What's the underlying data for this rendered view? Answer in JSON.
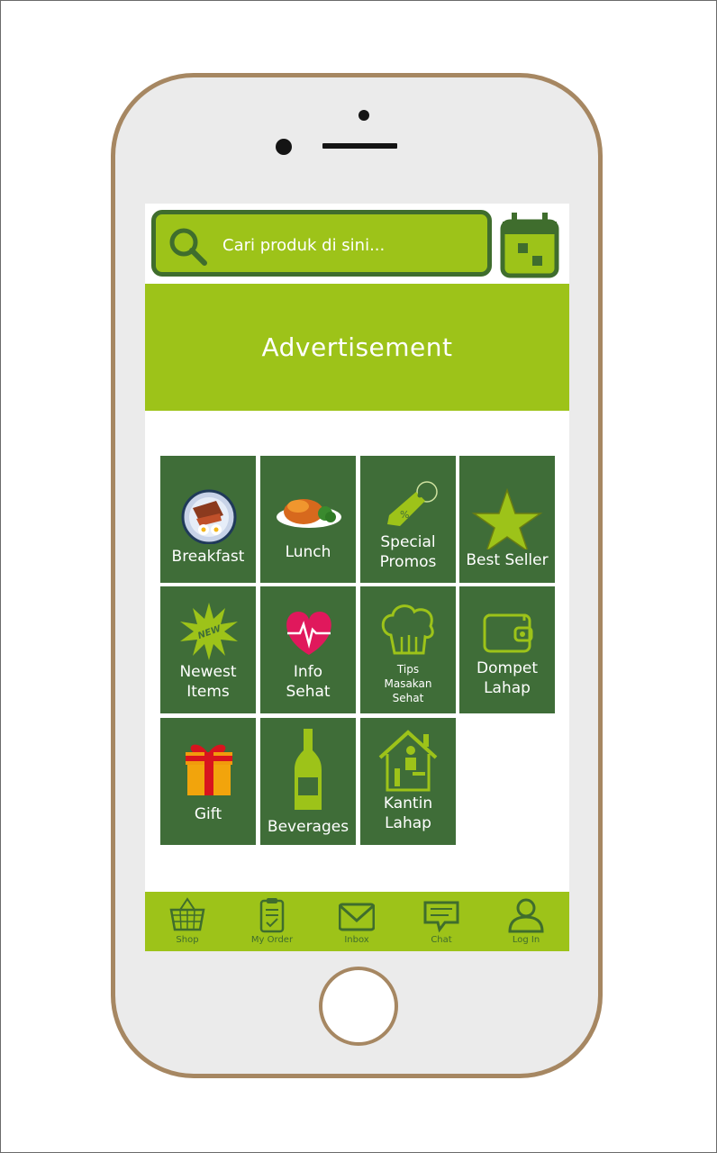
{
  "search": {
    "placeholder": "Cari produk di sini..."
  },
  "banner": {
    "text": "Advertisement"
  },
  "categories": [
    {
      "label": "Breakfast"
    },
    {
      "label": "Lunch"
    },
    {
      "label": "Special\nPromos"
    },
    {
      "label": "Best Seller"
    },
    {
      "label": "Newest\nItems",
      "badge": "NEW"
    },
    {
      "label": "Info\nSehat"
    },
    {
      "label": "Tips\nMasakan\nSehat"
    },
    {
      "label": "Dompet\nLahap"
    },
    {
      "label": "Gift"
    },
    {
      "label": "Beverages"
    },
    {
      "label": "Kantin\nLahap"
    }
  ],
  "promo_tag": "%",
  "nav": [
    {
      "label": "Shop",
      "icon": "basket-icon"
    },
    {
      "label": "My Order",
      "icon": "clipboard-icon"
    },
    {
      "label": "Inbox",
      "icon": "envelope-icon"
    },
    {
      "label": "Chat",
      "icon": "chat-bubble-icon"
    },
    {
      "label": "Log In",
      "icon": "user-icon"
    }
  ],
  "colors": {
    "accent": "#9dc319",
    "tile": "#3f6d38",
    "dark_green": "#3f6d2d",
    "phone_frame": "#a68762"
  }
}
